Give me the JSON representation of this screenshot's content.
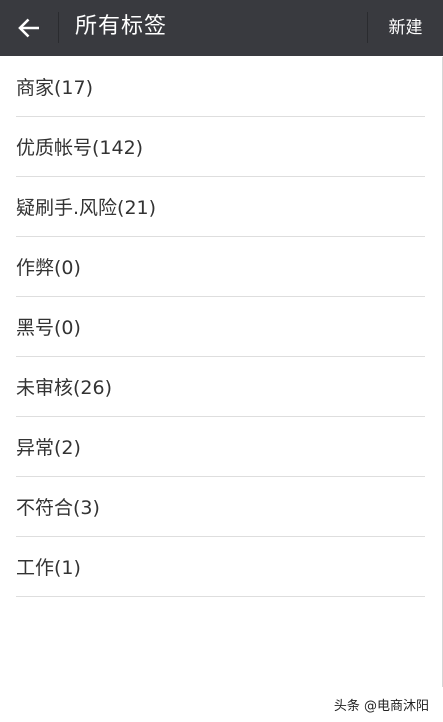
{
  "header": {
    "title": "所有标签",
    "new_label": "新建"
  },
  "tags": [
    {
      "label": "商家(17)"
    },
    {
      "label": "优质帐号(142)"
    },
    {
      "label": "疑刷手.风险(21)"
    },
    {
      "label": "作弊(0)"
    },
    {
      "label": "黑号(0)"
    },
    {
      "label": "未审核(26)"
    },
    {
      "label": "异常(2)"
    },
    {
      "label": "不符合(3)"
    },
    {
      "label": "工作(1)"
    }
  ],
  "watermark": "头条 @电商沐阳",
  "colors": {
    "header_bg": "#393a3f",
    "separator": "#dedede",
    "text": "#333333"
  },
  "icons": {
    "back": "back-arrow-icon"
  }
}
